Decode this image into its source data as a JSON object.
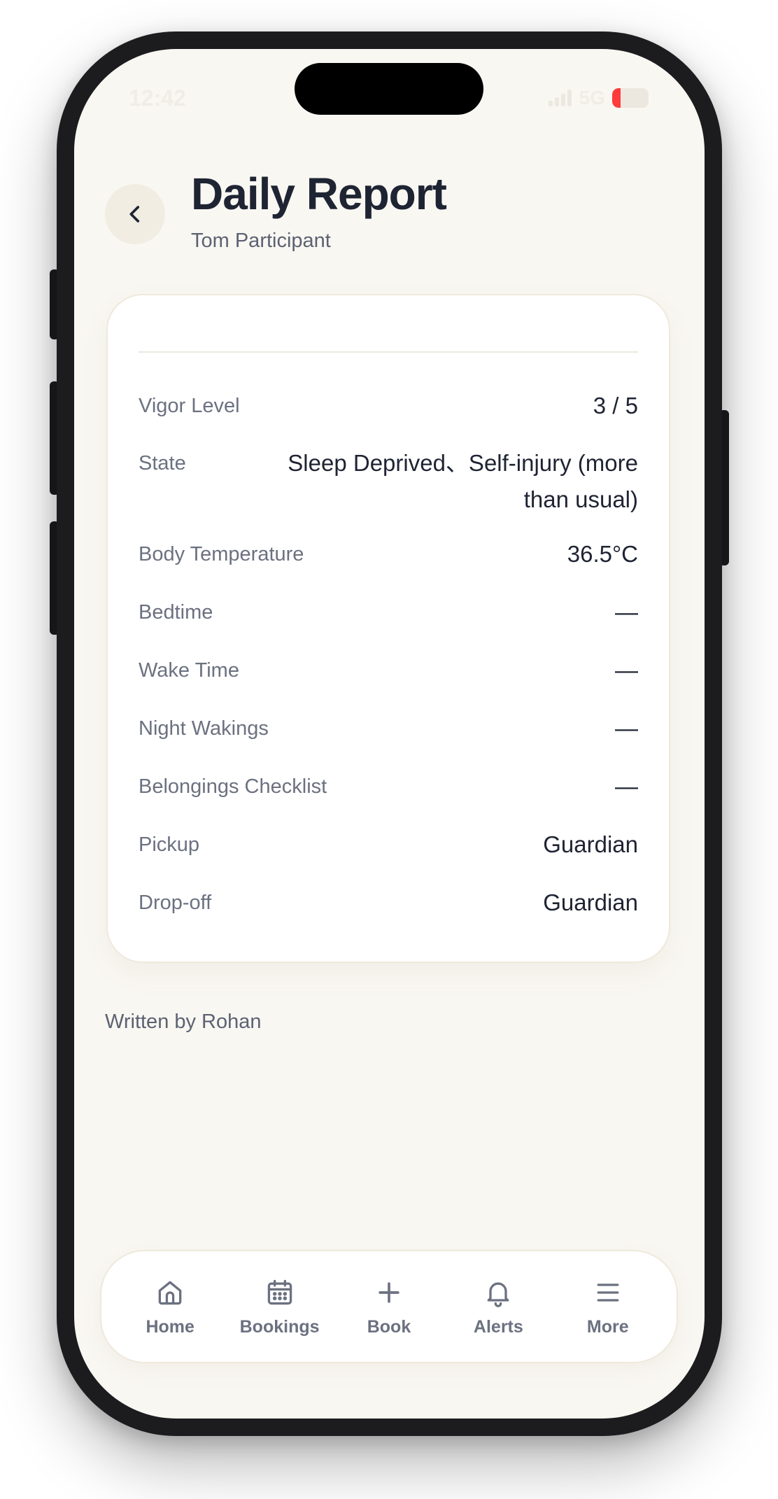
{
  "status_bar": {
    "time": "12:42",
    "network": "5G",
    "battery": "19"
  },
  "header": {
    "title": "Daily Report",
    "subtitle": "Tom Participant",
    "back_icon": "chevron-left-icon"
  },
  "report": {
    "rows": [
      {
        "label": "Vigor Level",
        "value": "3 / 5"
      },
      {
        "label": "State",
        "value": "Sleep Deprived、Self-injury (more than usual)"
      },
      {
        "label": "Body Temperature",
        "value": "36.5°C"
      },
      {
        "label": "Bedtime",
        "value": "—"
      },
      {
        "label": "Wake Time",
        "value": "—"
      },
      {
        "label": "Night Wakings",
        "value": "—"
      },
      {
        "label": "Belongings Checklist",
        "value": "—"
      },
      {
        "label": "Pickup",
        "value": "Guardian"
      },
      {
        "label": "Drop-off",
        "value": "Guardian"
      }
    ]
  },
  "footer": {
    "written_by": "Written by Rohan"
  },
  "tabbar": {
    "items": [
      {
        "label": "Home",
        "icon": "home-icon"
      },
      {
        "label": "Bookings",
        "icon": "calendar-icon"
      },
      {
        "label": "Book",
        "icon": "plus-icon"
      },
      {
        "label": "Alerts",
        "icon": "bell-icon"
      },
      {
        "label": "More",
        "icon": "menu-icon"
      }
    ]
  },
  "colors": {
    "background": "#f9f7f2",
    "card": "#ffffff",
    "text_primary": "#1f2433",
    "text_secondary": "#6b7180",
    "battery_low": "#ff3b3b"
  }
}
